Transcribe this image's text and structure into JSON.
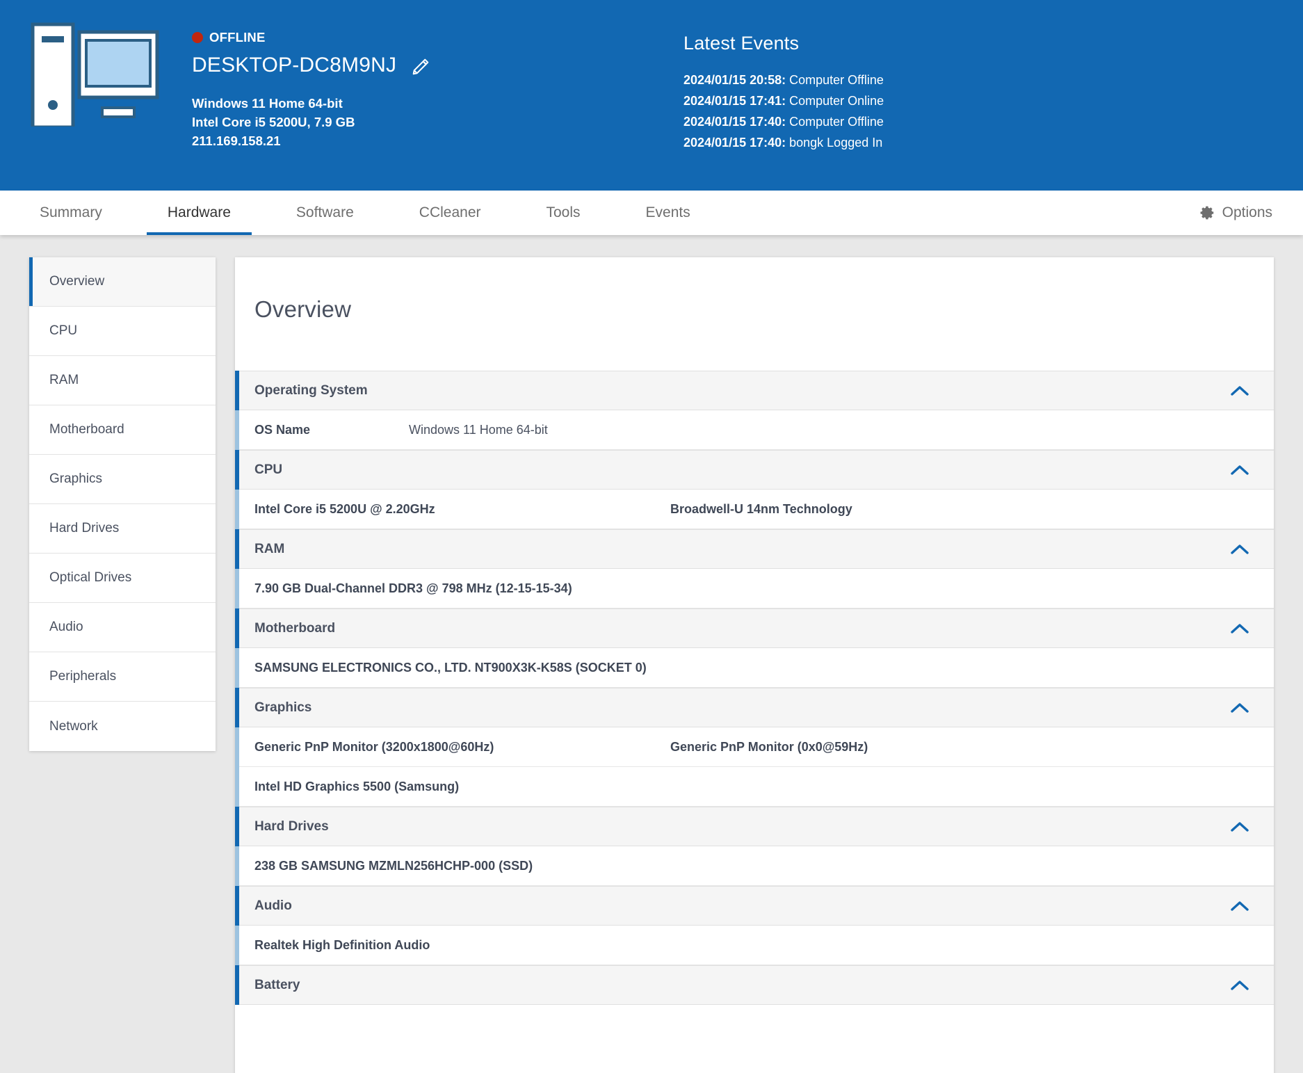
{
  "header": {
    "status_badge": "OFFLINE",
    "status_color": "#c0260f",
    "device_name": "DESKTOP-DC8M9NJ",
    "edit_icon": "pencil-icon",
    "spec_os": "Windows 11 Home 64-bit",
    "spec_cpu_ram": "Intel Core i5 5200U, 7.9 GB",
    "spec_ip": "211.169.158.21",
    "accent_color": "#1268b2",
    "events": {
      "title": "Latest Events",
      "items": [
        {
          "time": "2024/01/15 20:58:",
          "desc": "Computer Offline"
        },
        {
          "time": "2024/01/15 17:41:",
          "desc": "Computer Online"
        },
        {
          "time": "2024/01/15 17:40:",
          "desc": "Computer Offline"
        },
        {
          "time": "2024/01/15 17:40:",
          "desc": "bongk Logged In"
        }
      ]
    }
  },
  "tabs": [
    {
      "label": "Summary",
      "active": false
    },
    {
      "label": "Hardware",
      "active": true
    },
    {
      "label": "Software",
      "active": false
    },
    {
      "label": "CCleaner",
      "active": false
    },
    {
      "label": "Tools",
      "active": false
    },
    {
      "label": "Events",
      "active": false
    }
  ],
  "options": {
    "label": "Options",
    "icon": "gear-icon"
  },
  "sidebar": {
    "items": [
      {
        "label": "Overview",
        "active": true
      },
      {
        "label": "CPU",
        "active": false
      },
      {
        "label": "RAM",
        "active": false
      },
      {
        "label": "Motherboard",
        "active": false
      },
      {
        "label": "Graphics",
        "active": false
      },
      {
        "label": "Hard Drives",
        "active": false
      },
      {
        "label": "Optical Drives",
        "active": false
      },
      {
        "label": "Audio",
        "active": false
      },
      {
        "label": "Peripherals",
        "active": false
      },
      {
        "label": "Network",
        "active": false
      }
    ]
  },
  "panel": {
    "title": "Overview",
    "sections": [
      {
        "title": "Operating System",
        "chevron": "chevron-up-icon",
        "rows": [
          {
            "label": "OS Name",
            "value": "Windows 11 Home 64-bit"
          }
        ]
      },
      {
        "title": "CPU",
        "chevron": "chevron-up-icon",
        "rows": [
          {
            "col1": "Intel Core i5 5200U @ 2.20GHz",
            "col2": "Broadwell-U 14nm Technology"
          }
        ]
      },
      {
        "title": "RAM",
        "chevron": "chevron-up-icon",
        "rows": [
          {
            "full": "7.90 GB Dual-Channel DDR3 @ 798 MHz (12-15-15-34)"
          }
        ]
      },
      {
        "title": "Motherboard",
        "chevron": "chevron-up-icon",
        "rows": [
          {
            "full": "SAMSUNG ELECTRONICS CO., LTD. NT900X3K-K58S (SOCKET 0)"
          }
        ]
      },
      {
        "title": "Graphics",
        "chevron": "chevron-up-icon",
        "rows": [
          {
            "col1": "Generic PnP Monitor (3200x1800@60Hz)",
            "col2": "Generic PnP Monitor (0x0@59Hz)"
          },
          {
            "full": "Intel HD Graphics 5500 (Samsung)"
          }
        ]
      },
      {
        "title": "Hard Drives",
        "chevron": "chevron-up-icon",
        "rows": [
          {
            "full": "238 GB SAMSUNG MZMLN256HCHP-000 (SSD)"
          }
        ]
      },
      {
        "title": "Audio",
        "chevron": "chevron-up-icon",
        "rows": [
          {
            "full": "Realtek High Definition Audio"
          }
        ]
      },
      {
        "title": "Battery",
        "chevron": "chevron-up-icon",
        "rows": []
      }
    ]
  }
}
